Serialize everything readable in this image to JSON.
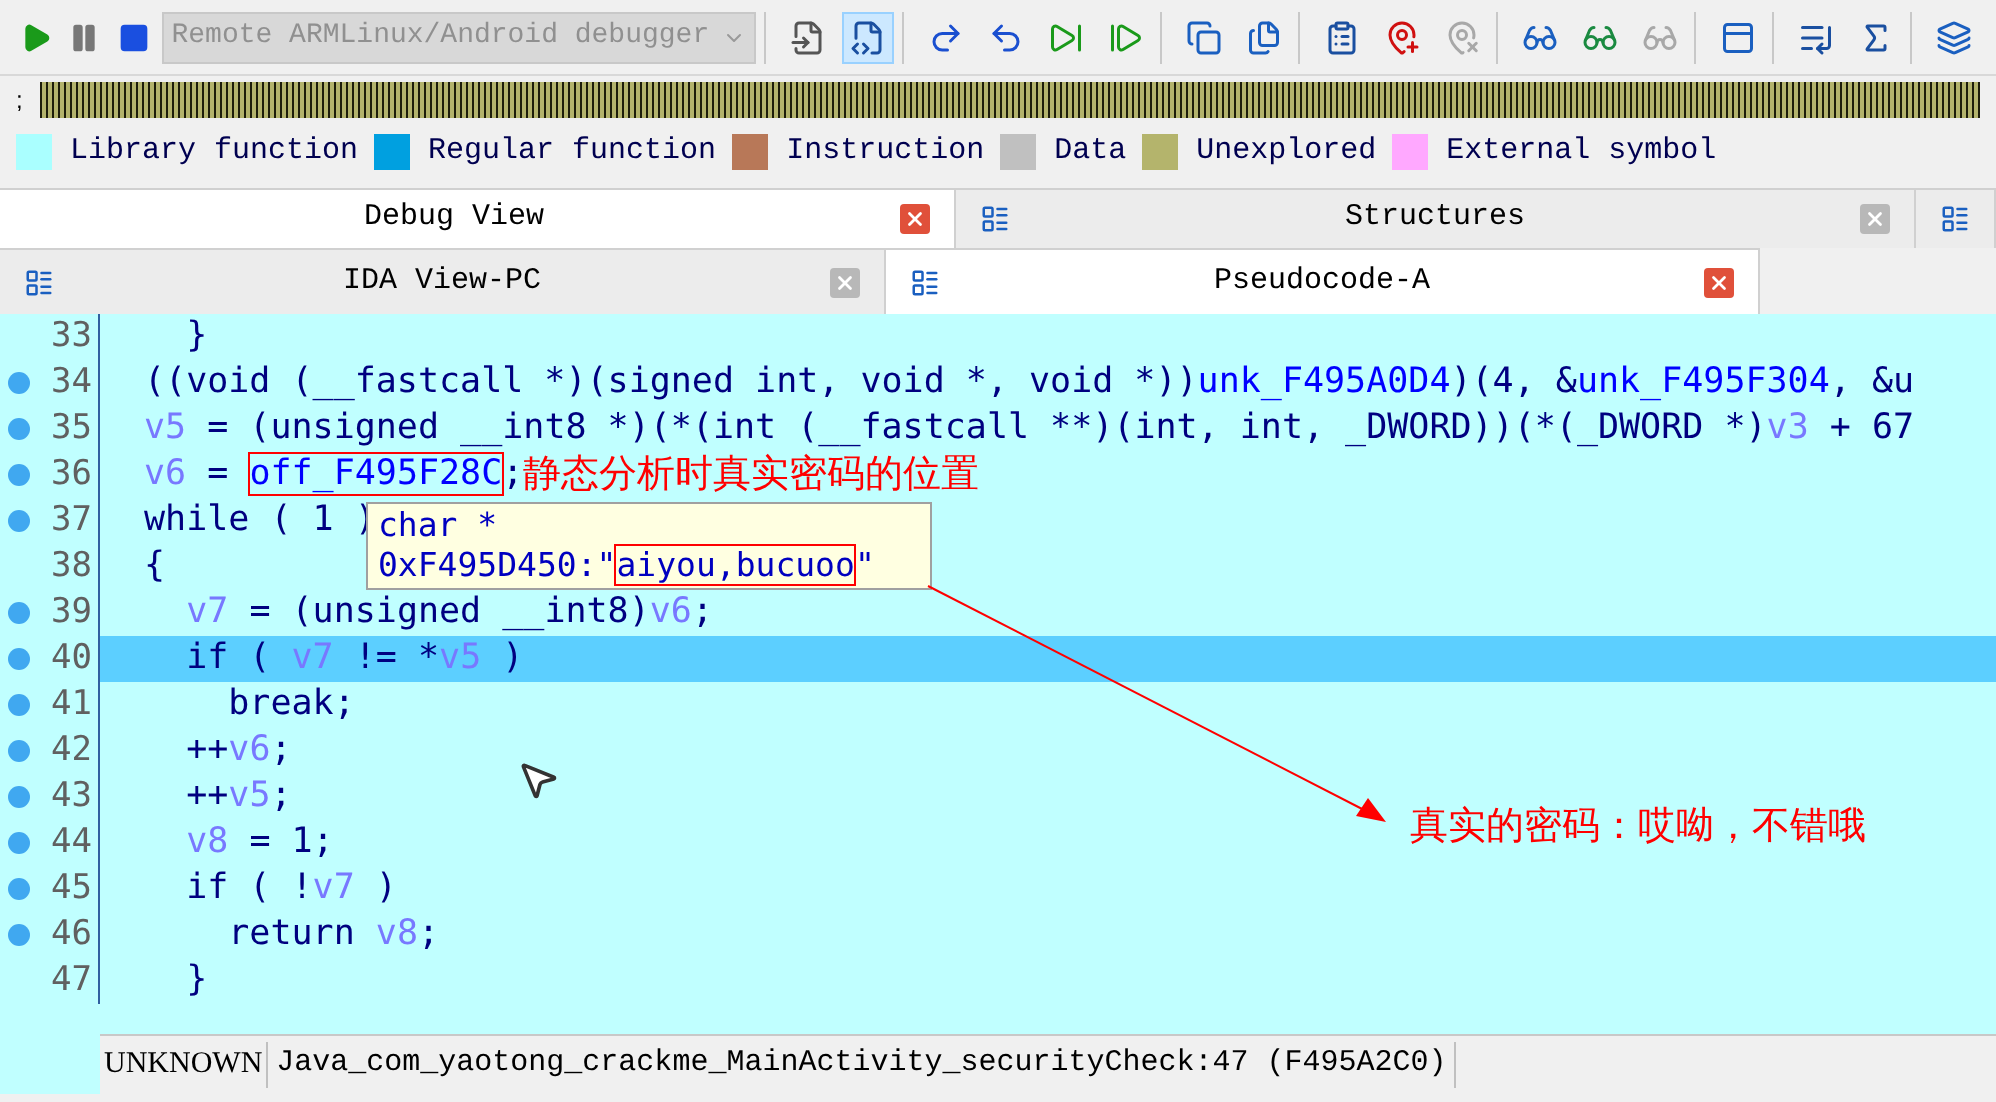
{
  "toolbar": {
    "debug_buttons": [
      {
        "kind": "play"
      },
      {
        "kind": "pause"
      },
      {
        "kind": "stop"
      }
    ],
    "debugger_select": {
      "value": "Remote ARMLinux/Android debugger",
      "disabled": true
    },
    "tool_groups": [
      [
        {
          "kind": "step-c",
          "pressed": false,
          "disabled": false
        },
        {
          "kind": "run-c",
          "pressed": true,
          "disabled": false
        }
      ],
      [
        {
          "kind": "step-into",
          "pressed": false,
          "disabled": false
        },
        {
          "kind": "step-over",
          "pressed": false,
          "disabled": false
        },
        {
          "kind": "run-to",
          "pressed": false,
          "disabled": false
        },
        {
          "kind": "run-cursor",
          "pressed": false,
          "disabled": false
        }
      ],
      [
        {
          "kind": "windows",
          "pressed": false,
          "disabled": false
        },
        {
          "kind": "window-doc",
          "pressed": false,
          "disabled": false
        }
      ],
      [
        {
          "kind": "bp-list",
          "pressed": false,
          "disabled": false
        },
        {
          "kind": "bp-add",
          "pressed": false,
          "disabled": false
        },
        {
          "kind": "bp-del",
          "pressed": false,
          "disabled": true
        }
      ],
      [
        {
          "kind": "watch",
          "pressed": false,
          "disabled": false
        },
        {
          "kind": "watch-add",
          "pressed": false,
          "disabled": false
        },
        {
          "kind": "watch-del",
          "pressed": false,
          "disabled": true
        }
      ],
      [
        {
          "kind": "trace",
          "pressed": false,
          "disabled": false
        }
      ],
      [
        {
          "kind": "trace-list",
          "pressed": false,
          "disabled": false
        },
        {
          "kind": "trace-func",
          "pressed": false,
          "disabled": false
        }
      ],
      [
        {
          "kind": "trace-stack",
          "pressed": false,
          "disabled": false
        }
      ]
    ]
  },
  "navigation": {
    "marker": ";"
  },
  "legend": [
    {
      "label": "Library function",
      "color": "#aaffff"
    },
    {
      "label": "Regular function",
      "color": "#00a0e0"
    },
    {
      "label": "Instruction",
      "color": "#b87858"
    },
    {
      "label": "Data",
      "color": "#c0c0c0"
    },
    {
      "label": "Unexplored",
      "color": "#b4b46c"
    },
    {
      "label": "External symbol",
      "color": "#ffa8ff"
    }
  ],
  "tab_rows": [
    [
      {
        "label": "Debug View",
        "selected": true,
        "icon": false
      },
      {
        "label": "Structures",
        "selected": false,
        "icon": true
      },
      {
        "selected": false,
        "icon": true,
        "kind": "icon-only"
      }
    ],
    [
      {
        "label": "IDA View-PC",
        "selected": false,
        "icon": true
      },
      {
        "label": "Pseudocode-A",
        "selected": true,
        "icon": true
      }
    ]
  ],
  "code": {
    "lines": [
      {
        "number": "33",
        "breakpoint": false,
        "current": false,
        "tokens": [
          {
            "t": "  }",
            "kind": "plain"
          }
        ]
      },
      {
        "number": "34",
        "breakpoint": true,
        "current": false,
        "tokens": [
          {
            "t": "((void (__fastcall *)(signed int, void *, void *))",
            "kind": "plain"
          },
          {
            "t": "unk_F495A0D4",
            "kind": "name"
          },
          {
            "t": ")(4, &",
            "kind": "plain"
          },
          {
            "t": "unk_F495F304",
            "kind": "name"
          },
          {
            "t": ", &u",
            "kind": "plain"
          }
        ]
      },
      {
        "number": "35",
        "breakpoint": true,
        "current": false,
        "tokens": [
          {
            "t": "v5",
            "kind": "variable"
          },
          {
            "t": " = (unsigned __int8 *)(*(int (__fastcall **)(int, int, _DWORD))(*(_DWORD *)",
            "kind": "plain"
          },
          {
            "t": "v3",
            "kind": "variable"
          },
          {
            "t": " + 67",
            "kind": "plain"
          }
        ]
      },
      {
        "number": "36",
        "breakpoint": true,
        "current": false,
        "tokens": [
          {
            "t": "v6",
            "kind": "variable"
          },
          {
            "t": " = ",
            "kind": "plain"
          },
          {
            "t": "off_F495F28C",
            "kind": "boxed"
          },
          {
            "t": ";",
            "kind": "plain"
          }
        ],
        "note": "静态分析时真实密码的位置"
      },
      {
        "number": "37",
        "breakpoint": true,
        "current": false,
        "tokens": [
          {
            "t": "while ( 1 )",
            "kind": "plain"
          }
        ]
      },
      {
        "number": "38",
        "breakpoint": false,
        "current": false,
        "tokens": [
          {
            "t": "{",
            "kind": "plain"
          }
        ]
      },
      {
        "number": "39",
        "breakpoint": true,
        "current": false,
        "tokens": [
          {
            "t": "  v7",
            "kind": "variable"
          },
          {
            "t": " = (unsigned __int8)",
            "kind": "plain"
          },
          {
            "t": "v6",
            "kind": "variable"
          },
          {
            "t": ";",
            "kind": "plain"
          }
        ]
      },
      {
        "number": "40",
        "breakpoint": true,
        "current": true,
        "tokens": [
          {
            "t": "  if ( ",
            "kind": "plain"
          },
          {
            "t": "v7",
            "kind": "variable"
          },
          {
            "t": " != *",
            "kind": "plain"
          },
          {
            "t": "v5",
            "kind": "variable"
          },
          {
            "t": " )",
            "kind": "plain"
          }
        ]
      },
      {
        "number": "41",
        "breakpoint": true,
        "current": false,
        "tokens": [
          {
            "t": "    break;",
            "kind": "plain"
          }
        ]
      },
      {
        "number": "42",
        "breakpoint": true,
        "current": false,
        "tokens": [
          {
            "t": "  ++",
            "kind": "plain"
          },
          {
            "t": "v6",
            "kind": "variable"
          },
          {
            "t": ";",
            "kind": "plain"
          }
        ]
      },
      {
        "number": "43",
        "breakpoint": true,
        "current": false,
        "tokens": [
          {
            "t": "  ++",
            "kind": "plain"
          },
          {
            "t": "v5",
            "kind": "variable"
          },
          {
            "t": ";",
            "kind": "plain"
          }
        ]
      },
      {
        "number": "44",
        "breakpoint": true,
        "current": false,
        "tokens": [
          {
            "t": "  v8",
            "kind": "variable"
          },
          {
            "t": " = 1;",
            "kind": "plain"
          }
        ]
      },
      {
        "number": "45",
        "breakpoint": true,
        "current": false,
        "tokens": [
          {
            "t": "  if ( !",
            "kind": "plain"
          },
          {
            "t": "v7",
            "kind": "variable"
          },
          {
            "t": " )",
            "kind": "plain"
          }
        ]
      },
      {
        "number": "46",
        "breakpoint": true,
        "current": false,
        "tokens": [
          {
            "t": "    return ",
            "kind": "plain"
          },
          {
            "t": "v8",
            "kind": "variable"
          },
          {
            "t": ";",
            "kind": "plain"
          }
        ]
      },
      {
        "number": "47",
        "breakpoint": false,
        "current": false,
        "tokens": [
          {
            "t": "  }",
            "kind": "plain"
          }
        ]
      }
    ],
    "hint": {
      "type_line": "char *",
      "address": "0xF495D450:\"",
      "value": "aiyou,bucuoo",
      "closing": "\""
    },
    "annotation": "真实的密码：哎呦，不错哦"
  },
  "status_bar": {
    "segment": "UNKNOWN",
    "location": "Java_com_yaotong_crackme_MainActivity_securityCheck:47 (F495A2C0)"
  }
}
